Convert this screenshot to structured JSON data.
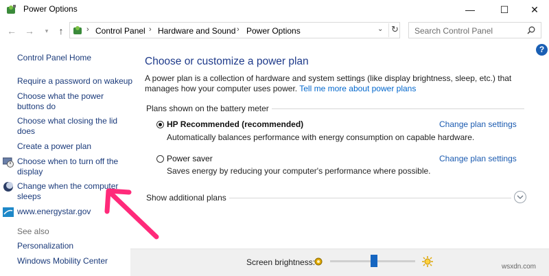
{
  "window": {
    "title": "Power Options",
    "minimize": "—",
    "maximize": "☐",
    "close": "✕"
  },
  "address": {
    "breadcrumbs": [
      "Control Panel",
      "Hardware and Sound",
      "Power Options"
    ],
    "search_placeholder": "Search Control Panel"
  },
  "sidebar": {
    "home": "Control Panel Home",
    "items": [
      {
        "label": "Require a password on wakeup"
      },
      {
        "label": "Choose what the power\nbuttons do"
      },
      {
        "label": "Choose what closing the lid\ndoes"
      },
      {
        "label": "Create a power plan"
      },
      {
        "label": "Choose when to turn off the\ndisplay"
      },
      {
        "label": "Change when the computer\nsleeps"
      },
      {
        "label": "www.energystar.gov"
      }
    ],
    "see_also": "See also",
    "see_also_items": [
      "Personalization",
      "Windows Mobility Center"
    ]
  },
  "main": {
    "heading": "Choose or customize a power plan",
    "intro_text": "A power plan is a collection of hardware and system settings (like display brightness, sleep, etc.) that manages how your computer uses power.",
    "intro_link": "Tell me more about power plans",
    "group_label": "Plans shown on the battery meter",
    "plans": [
      {
        "name": "HP Recommended (recommended)",
        "description": "Automatically balances performance with energy consumption on capable hardware.",
        "selected": true,
        "link": "Change plan settings"
      },
      {
        "name": "Power saver",
        "description": "Saves energy by reducing your computer's performance where possible.",
        "selected": false,
        "link": "Change plan settings"
      }
    ],
    "additional_plans": "Show additional plans"
  },
  "bottom": {
    "brightness_label": "Screen brightness:",
    "brightness_level": 0.52
  },
  "watermark": "wsxdn.com",
  "colors": {
    "accent_arrow": "#ff2a7a",
    "link": "#1a5ab0",
    "heading": "#1e3a8a"
  }
}
